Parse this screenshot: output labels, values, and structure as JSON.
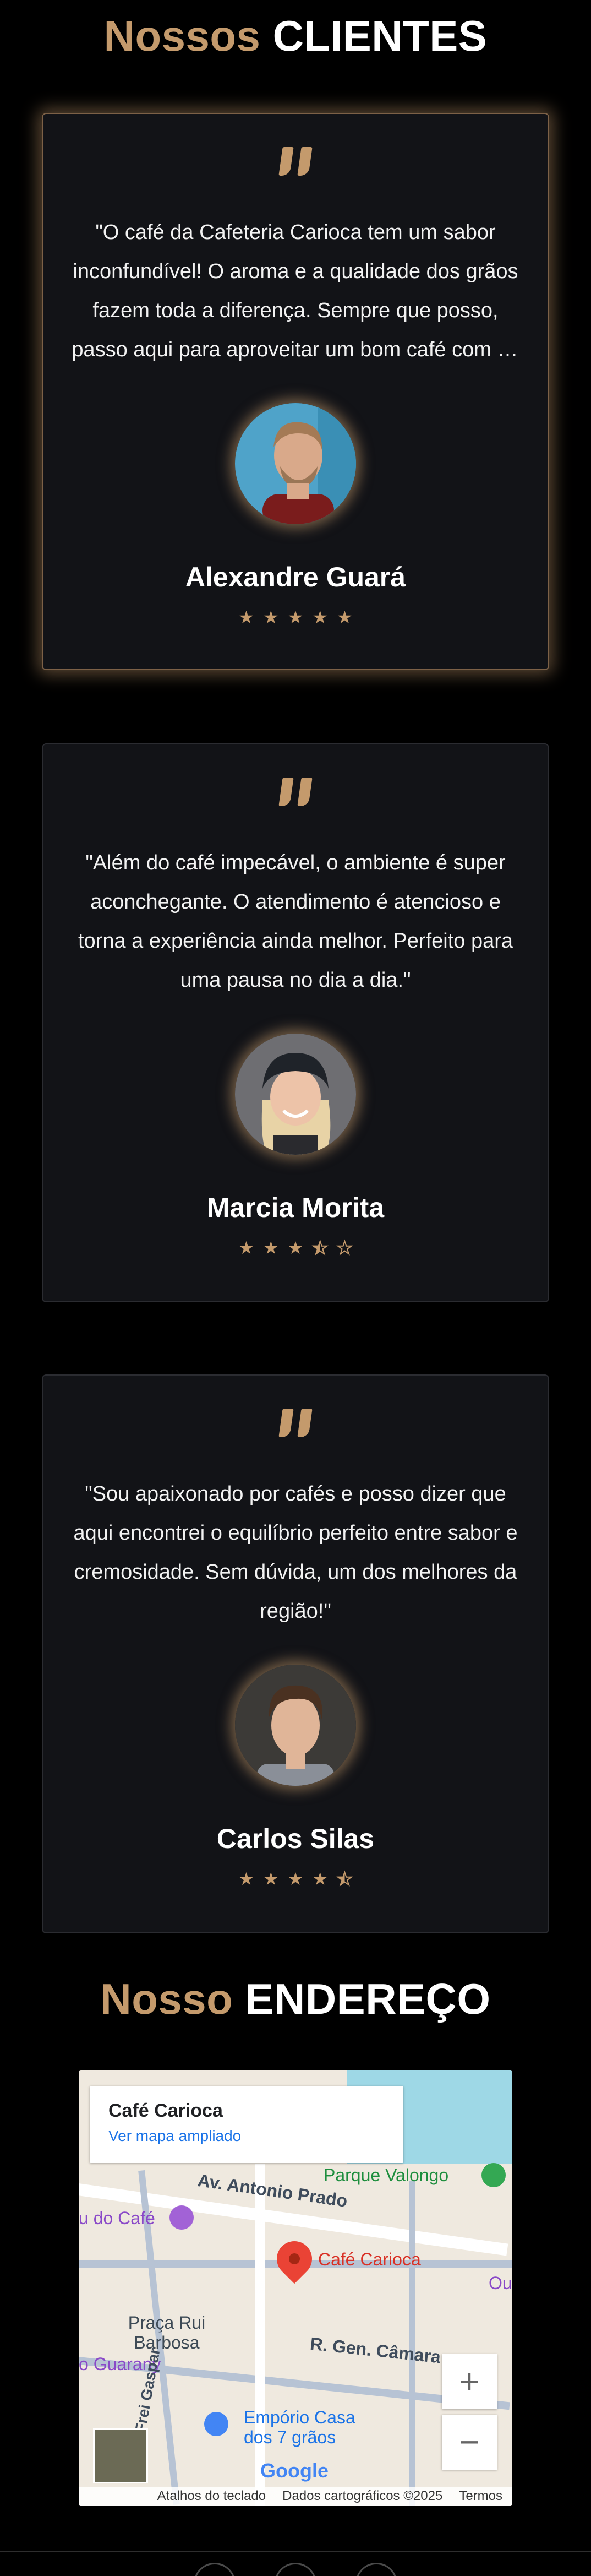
{
  "clients_section": {
    "title_accent": "Nossos",
    "title_main": "CLIENTES"
  },
  "testimonials": [
    {
      "text": "\"O café da Cafeteria Carioca tem um sabor inconfundível! O aroma e a qualidade dos grãos fazem toda a diferença. Sempre que posso, passo aqui para aproveitar um bom café com os amigos.\"",
      "name": "Alexandre Guará",
      "rating": 5
    },
    {
      "text": "\"Além do café impecável, o ambiente é super aconchegante. O atendimento é atencioso e torna a experiência ainda melhor. Perfeito para uma pausa no dia a dia.\"",
      "name": "Marcia Morita",
      "rating": 3.5
    },
    {
      "text": "\"Sou apaixonado por cafés e posso dizer que aqui encontrei o equilíbrio perfeito entre sabor e cremosidade. Sem dúvida, um dos melhores da região!\"",
      "name": "Carlos Silas",
      "rating": 4.5
    }
  ],
  "address_section": {
    "title_accent": "Nosso",
    "title_main": "ENDEREÇO"
  },
  "map": {
    "place_title": "Café Carioca",
    "view_larger": "Ver mapa ampliado",
    "labels": {
      "park": "Parque Valongo",
      "street1": "Av. Antonio Prado",
      "cafe_left": "u do Café",
      "pin_label": "Café Carioca",
      "outeiro": "Outeiro",
      "praca": "Praça Rui Barbosa",
      "street2": "R. Gen. Câmara",
      "guarany": "o Guarany",
      "gaspar": "R. Frei Gaspar",
      "emporio": "Empório Casa dos 7 grãos"
    },
    "zoom_in": "+",
    "zoom_out": "−",
    "google": "Google",
    "footer": {
      "shortcuts": "Atalhos do teclado",
      "map_data": "Dados cartográficos ©2025",
      "terms": "Termos"
    }
  },
  "colors": {
    "accent": "#c49a6c",
    "background": "#000000",
    "card": "#121317"
  }
}
